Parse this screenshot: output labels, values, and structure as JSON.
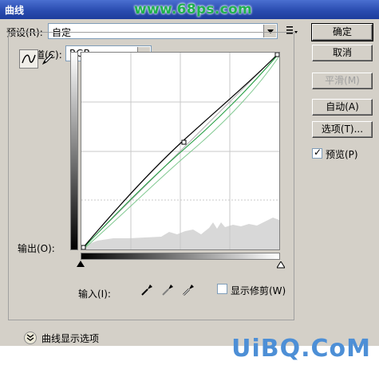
{
  "window": {
    "title": "曲线",
    "watermark_top": "www.68ps.com"
  },
  "preset": {
    "label": "预设(R):",
    "value": "自定"
  },
  "channel": {
    "label": "通道(C):",
    "value": "RGB"
  },
  "axes": {
    "output_label": "输出(O):",
    "input_label": "输入(I):"
  },
  "buttons": {
    "ok": "确定",
    "cancel": "取消",
    "smooth": "平滑(M)",
    "auto": "自动(A)",
    "options": "选项(T)..."
  },
  "preview": {
    "label": "预览(P)",
    "checked": true
  },
  "show_clipping": {
    "label": "显示修剪(W)",
    "checked": false
  },
  "curve_display_options": "曲线显示选项",
  "watermark_bottom": "UiBQ.CoM",
  "icons": {
    "presets_menu": "list-menu-icon",
    "curve_tool": "curve-tool-icon",
    "pencil_tool": "pencil-icon",
    "eyedroppers": [
      "black-eyedropper-icon",
      "gray-eyedropper-icon",
      "white-eyedropper-icon"
    ],
    "expand": "double-chevron-down-icon"
  },
  "colors": {
    "curve": "#000000",
    "green_channel": "#1a9a3a",
    "histogram": "#d8d8d8"
  }
}
